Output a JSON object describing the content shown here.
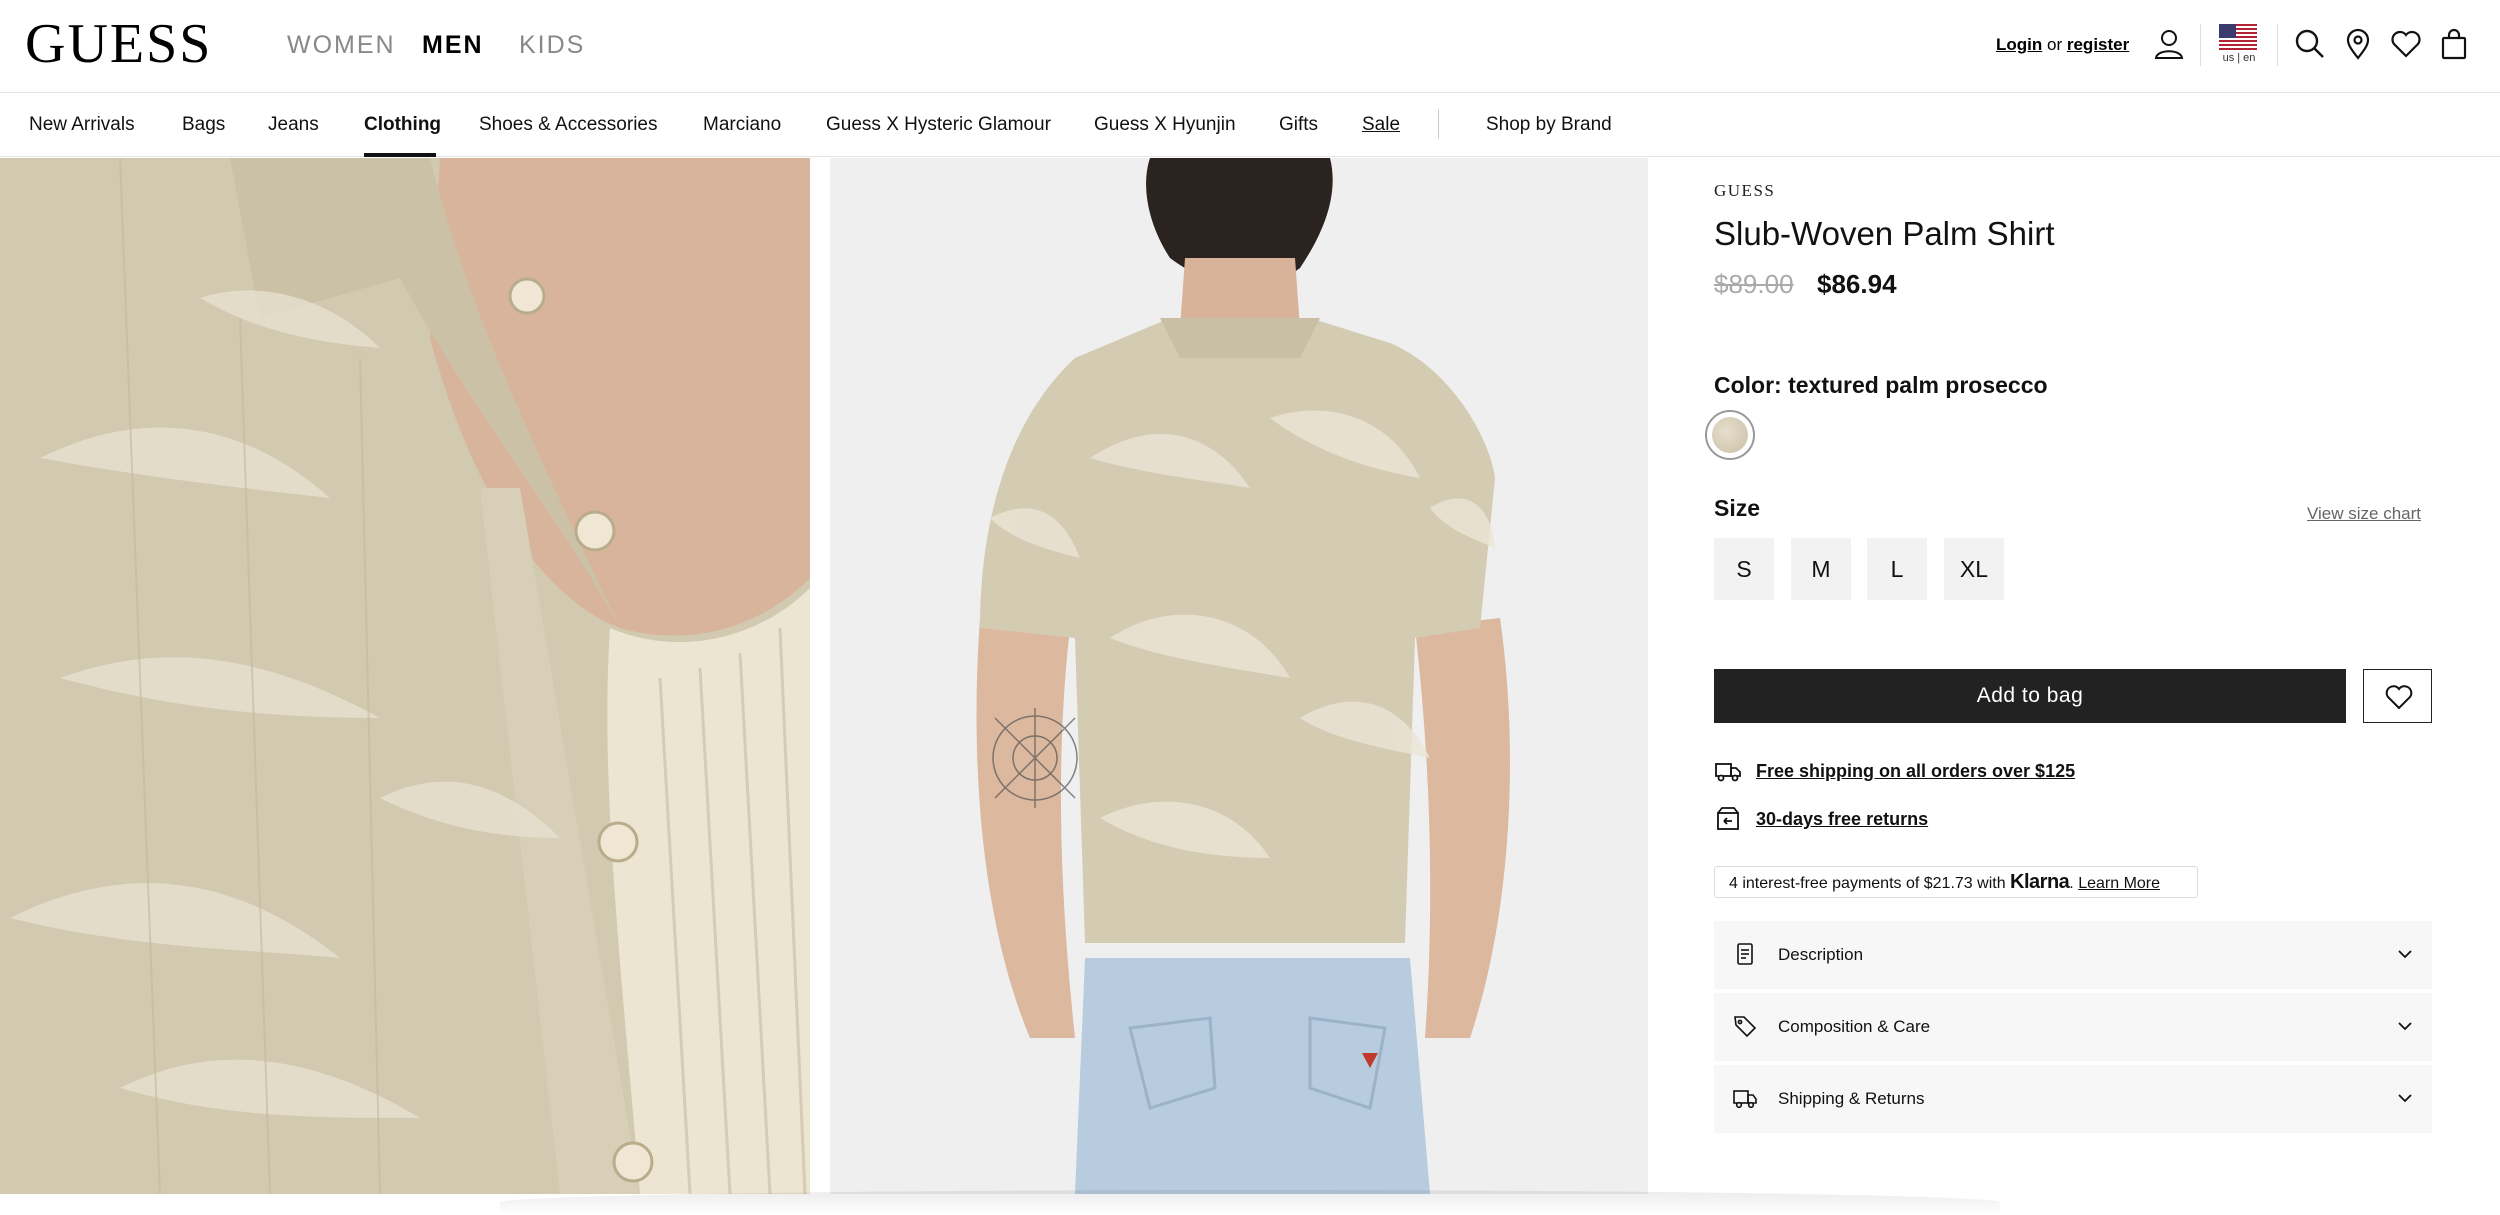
{
  "header": {
    "logo": "GUESS",
    "genders": [
      {
        "label": "WOMEN",
        "active": false
      },
      {
        "label": "MEN",
        "active": true
      },
      {
        "label": "KIDS",
        "active": false
      }
    ],
    "login_label": "Login",
    "or_label": "or",
    "register_label": "register",
    "locale_label": "us | en",
    "icons": [
      "user-icon",
      "us-flag-icon",
      "search-icon",
      "location-pin-icon",
      "heart-icon",
      "shopping-bag-icon"
    ]
  },
  "nav": {
    "items": [
      {
        "label": "New Arrivals"
      },
      {
        "label": "Bags"
      },
      {
        "label": "Jeans"
      },
      {
        "label": "Clothing",
        "active": true
      },
      {
        "label": "Shoes & Accessories"
      },
      {
        "label": "Marciano"
      },
      {
        "label": "Guess X Hysteric Glamour"
      },
      {
        "label": "Guess X Hyunjin"
      },
      {
        "label": "Gifts"
      },
      {
        "label": "Sale"
      },
      {
        "label": "Shop by Brand"
      }
    ]
  },
  "product": {
    "brand": "GUESS",
    "title": "Slub-Woven Palm Shirt",
    "original_price": "$89.00",
    "sale_price": "$86.94",
    "color_label": "Color: textured palm prosecco",
    "size_label": "Size",
    "size_chart_label": "View size chart",
    "sizes": [
      "S",
      "M",
      "L",
      "XL"
    ],
    "add_to_bag_label": "Add to bag",
    "perks": [
      {
        "icon": "truck-icon",
        "label": "Free shipping on all orders over $125"
      },
      {
        "icon": "return-box-icon",
        "label": "30-days free returns"
      }
    ],
    "klarna": {
      "text": "4 interest-free payments of $21.73 with",
      "brand": "Klarna",
      "suffix": ".",
      "learn_more": "Learn More"
    },
    "accordions": [
      {
        "icon": "document-icon",
        "label": "Description"
      },
      {
        "icon": "tag-icon",
        "label": "Composition & Care"
      },
      {
        "icon": "truck-icon",
        "label": "Shipping & Returns"
      }
    ]
  },
  "colors": {
    "primary_button": "#222222",
    "swatch": "#D8CFB8",
    "muted_price": "#AAAAAA"
  }
}
